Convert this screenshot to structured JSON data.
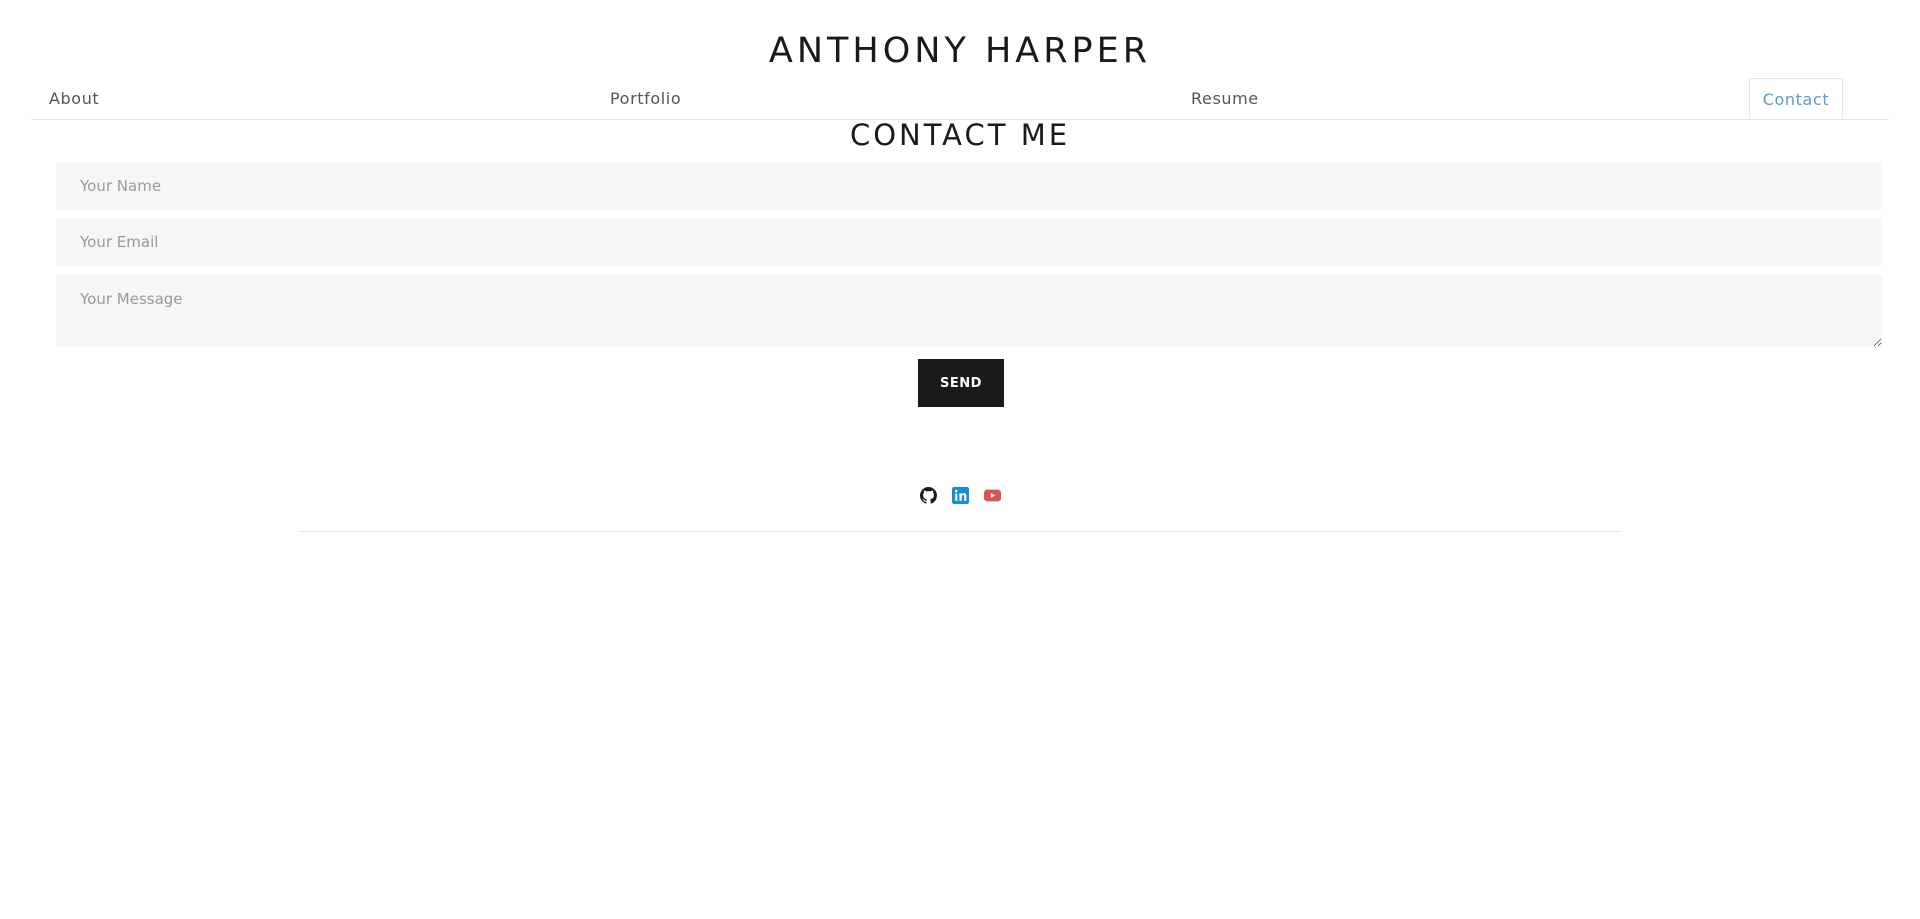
{
  "header": {
    "site_title": "ANTHONY HARPER"
  },
  "nav": {
    "items": [
      {
        "label": "About"
      },
      {
        "label": "Portfolio"
      },
      {
        "label": "Resume"
      },
      {
        "label": "Contact",
        "active": true
      }
    ],
    "active_color": "#5b9bd5"
  },
  "contact": {
    "title": "CONTACT ME",
    "name_placeholder": "Your Name",
    "email_placeholder": "Your Email",
    "message_placeholder": "Your Message",
    "send_label": "SEND"
  },
  "socials": {
    "items": [
      {
        "icon": "github-icon",
        "color": "#1a1a1a"
      },
      {
        "icon": "linkedin-icon",
        "color": "#1b8ed1"
      },
      {
        "icon": "youtube-icon",
        "color": "#d9534f"
      }
    ]
  }
}
